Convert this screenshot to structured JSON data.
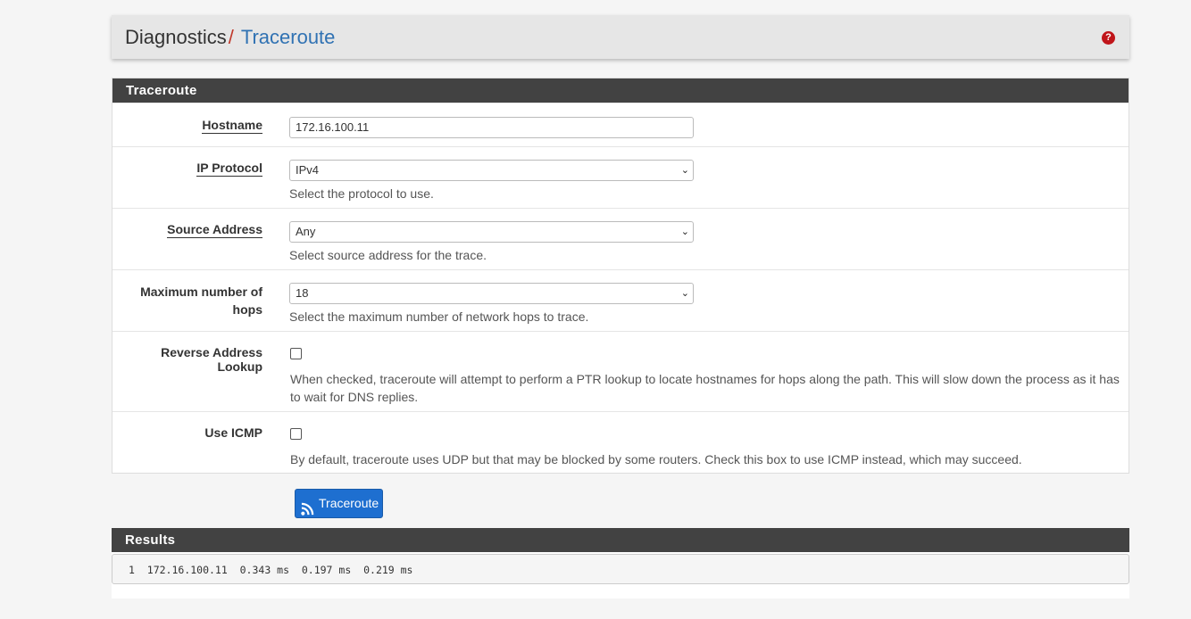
{
  "breadcrumb": {
    "parent": "Diagnostics",
    "separator": "/",
    "current": "Traceroute",
    "help_icon": "question-circle-icon"
  },
  "form": {
    "heading": "Traceroute",
    "hostname": {
      "label": "Hostname",
      "value": "172.16.100.11"
    },
    "ip_protocol": {
      "label": "IP Protocol",
      "value": "IPv4",
      "help": "Select the protocol to use."
    },
    "source_address": {
      "label": "Source Address",
      "value": "Any",
      "help": "Select source address for the trace."
    },
    "max_hops": {
      "label_line1": "Maximum number of",
      "label_line2": "hops",
      "value": "18",
      "help": "Select the maximum number of network hops to trace."
    },
    "reverse_lookup": {
      "label": "Reverse Address Lookup",
      "checked": false,
      "help_line1": "When checked, traceroute will attempt to perform a PTR lookup to locate hostnames for hops along the path. This will slow down the process as it has",
      "help_line2": "to wait for DNS replies."
    },
    "use_icmp": {
      "label": "Use ICMP",
      "checked": false,
      "help": "By default, traceroute uses UDP but that may be blocked by some routers. Check this box to use ICMP instead, which may succeed."
    },
    "submit_label": "Traceroute",
    "submit_icon": "rss-icon"
  },
  "results": {
    "heading": "Results",
    "output": "1  172.16.100.11  0.343 ms  0.197 ms  0.219 ms"
  },
  "colors": {
    "panel_heading": "#424242",
    "link": "#3072b3",
    "button": "#1e6fd0",
    "help_icon": "#c0151a"
  }
}
